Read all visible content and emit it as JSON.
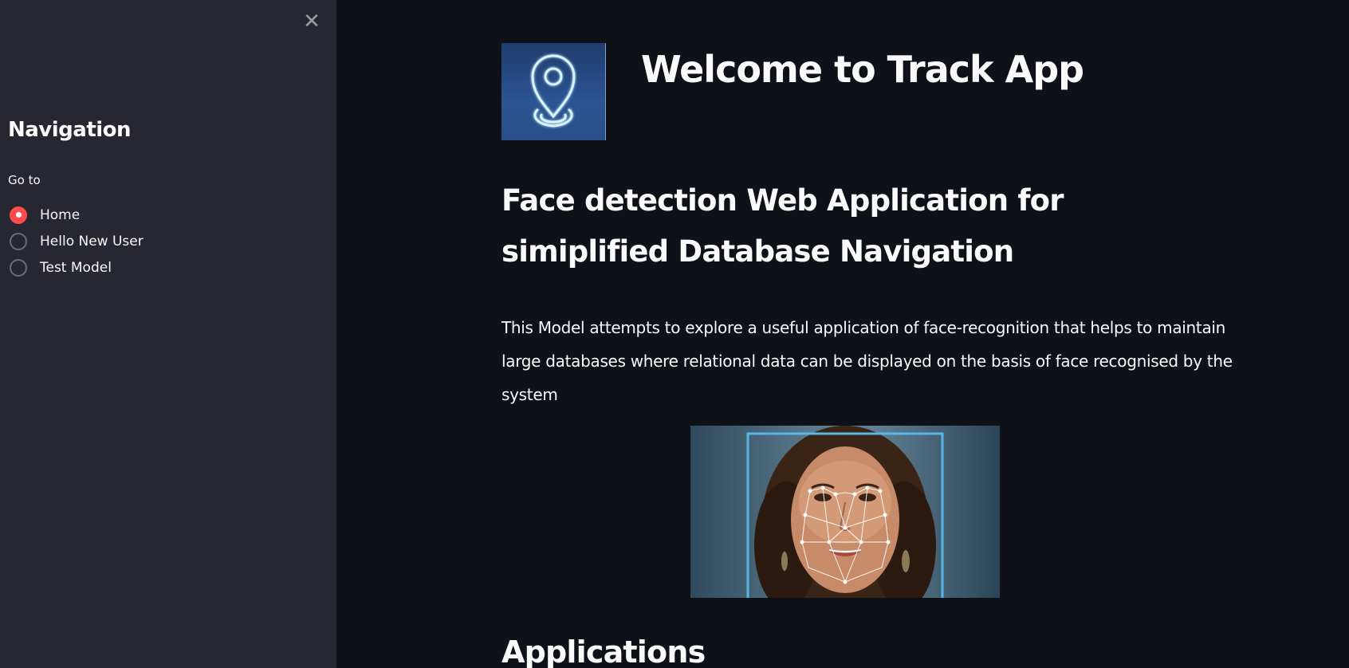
{
  "sidebar": {
    "close_glyph": "✕",
    "title": "Navigation",
    "radio_label": "Go to",
    "options": [
      {
        "label": "Home",
        "selected": true
      },
      {
        "label": "Hello New User",
        "selected": false
      },
      {
        "label": "Test Model",
        "selected": false
      }
    ]
  },
  "main": {
    "logo_icon": "location-pin-icon",
    "title": "Welcome to Track App",
    "subtitle": "Face detection Web Application for simiplified Database Navigation",
    "description": "This Model attempts to explore a useful application of face-recognition that helps to maintain large databases where relational data can be displayed on the basis of face recognised by the system",
    "image": "face-recognition-landmarks-photo",
    "section_heading": "Applications"
  },
  "colors": {
    "sidebar_bg": "#262730",
    "main_bg": "#0e1117",
    "accent": "#ff4b4b",
    "text": "#fafafa"
  }
}
